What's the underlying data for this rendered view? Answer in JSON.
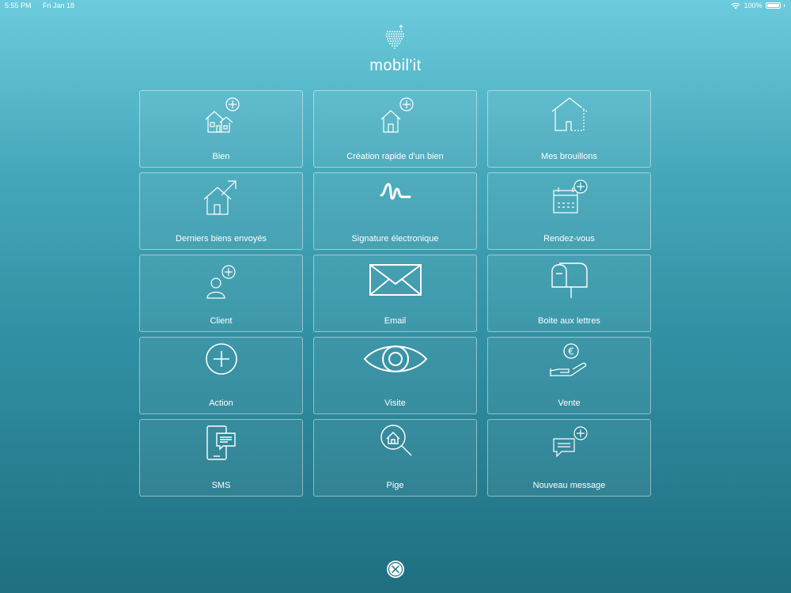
{
  "status_bar": {
    "time": "5:55 PM",
    "date": "Fri Jan 18",
    "battery": "100%"
  },
  "logo": {
    "text": "mobil'it"
  },
  "tiles": [
    {
      "label": "Bien",
      "icon": "house-add-icon"
    },
    {
      "label": "Création rapide d'un bien",
      "icon": "house-quick-add-icon"
    },
    {
      "label": "Mes brouillons",
      "icon": "house-draft-icon"
    },
    {
      "label": "Derniers biens envoyés",
      "icon": "house-sent-icon"
    },
    {
      "label": "Signature électronique",
      "icon": "signature-icon"
    },
    {
      "label": "Rendez-vous",
      "icon": "calendar-add-icon"
    },
    {
      "label": "Client",
      "icon": "user-add-icon"
    },
    {
      "label": "Email",
      "icon": "envelope-icon"
    },
    {
      "label": "Boite aux lettres",
      "icon": "mailbox-icon"
    },
    {
      "label": "Action",
      "icon": "plus-circle-icon"
    },
    {
      "label": "Visite",
      "icon": "eye-icon"
    },
    {
      "label": "Vente",
      "icon": "hand-euro-icon"
    },
    {
      "label": "SMS",
      "icon": "phone-message-icon"
    },
    {
      "label": "Pige",
      "icon": "house-search-icon"
    },
    {
      "label": "Nouveau message",
      "icon": "message-add-icon"
    }
  ],
  "close": {
    "icon": "close-icon"
  }
}
